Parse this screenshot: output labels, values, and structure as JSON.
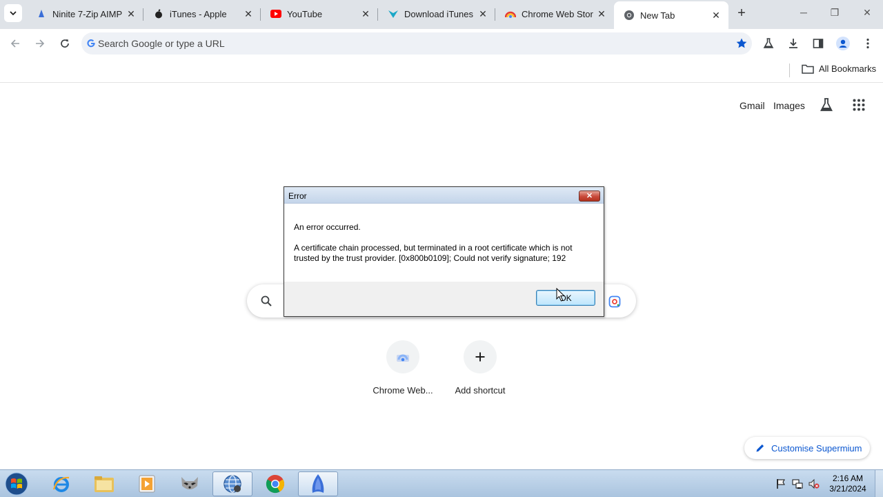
{
  "browser": {
    "tabs": [
      {
        "title": "Ninite 7-Zip AIMP",
        "icon": "ninite-icon",
        "active": false
      },
      {
        "title": "iTunes - Apple",
        "icon": "apple-icon",
        "active": false
      },
      {
        "title": "YouTube",
        "icon": "youtube-icon",
        "active": false
      },
      {
        "title": "Download iTunes",
        "icon": "download-site-icon",
        "active": false
      },
      {
        "title": "Chrome Web Stor",
        "icon": "chrome-web-store-icon",
        "active": false
      },
      {
        "title": "New Tab",
        "icon": "chromium-icon",
        "active": true
      }
    ],
    "omnibox": {
      "placeholder": "Search Google or type a URL",
      "value": ""
    },
    "bookmarks": {
      "all_bookmarks_label": "All Bookmarks"
    }
  },
  "ntp": {
    "links": {
      "gmail": "Gmail",
      "images": "Images"
    },
    "shortcuts": [
      {
        "label": "Chrome Web...",
        "icon": "chrome-web-store-icon"
      },
      {
        "label": "Add shortcut",
        "icon": "plus-icon"
      }
    ],
    "customise_label": "Customise Supermium"
  },
  "dialog": {
    "title": "Error",
    "message_heading": "An error occurred.",
    "message_detail": "A certificate chain processed, but terminated in a root certificate which is not trusted by the trust provider. [0x800b0109]; Could not verify signature; 192",
    "ok_label": "OK",
    "close_glyph": "✕"
  },
  "taskbar": {
    "apps": [
      {
        "name": "internet-explorer",
        "active": false
      },
      {
        "name": "file-explorer",
        "active": false
      },
      {
        "name": "media-player",
        "active": false
      },
      {
        "name": "raccoon-app",
        "active": false
      },
      {
        "name": "network-globe",
        "active": true
      },
      {
        "name": "chrome",
        "active": false
      },
      {
        "name": "installer-app",
        "active": true
      }
    ],
    "clock": {
      "time": "2:16 AM",
      "date": "3/21/2024"
    }
  },
  "colors": {
    "accent": "#0b57d0",
    "tabstrip": "#dfe3e8",
    "omnibox": "#eef1f6"
  }
}
